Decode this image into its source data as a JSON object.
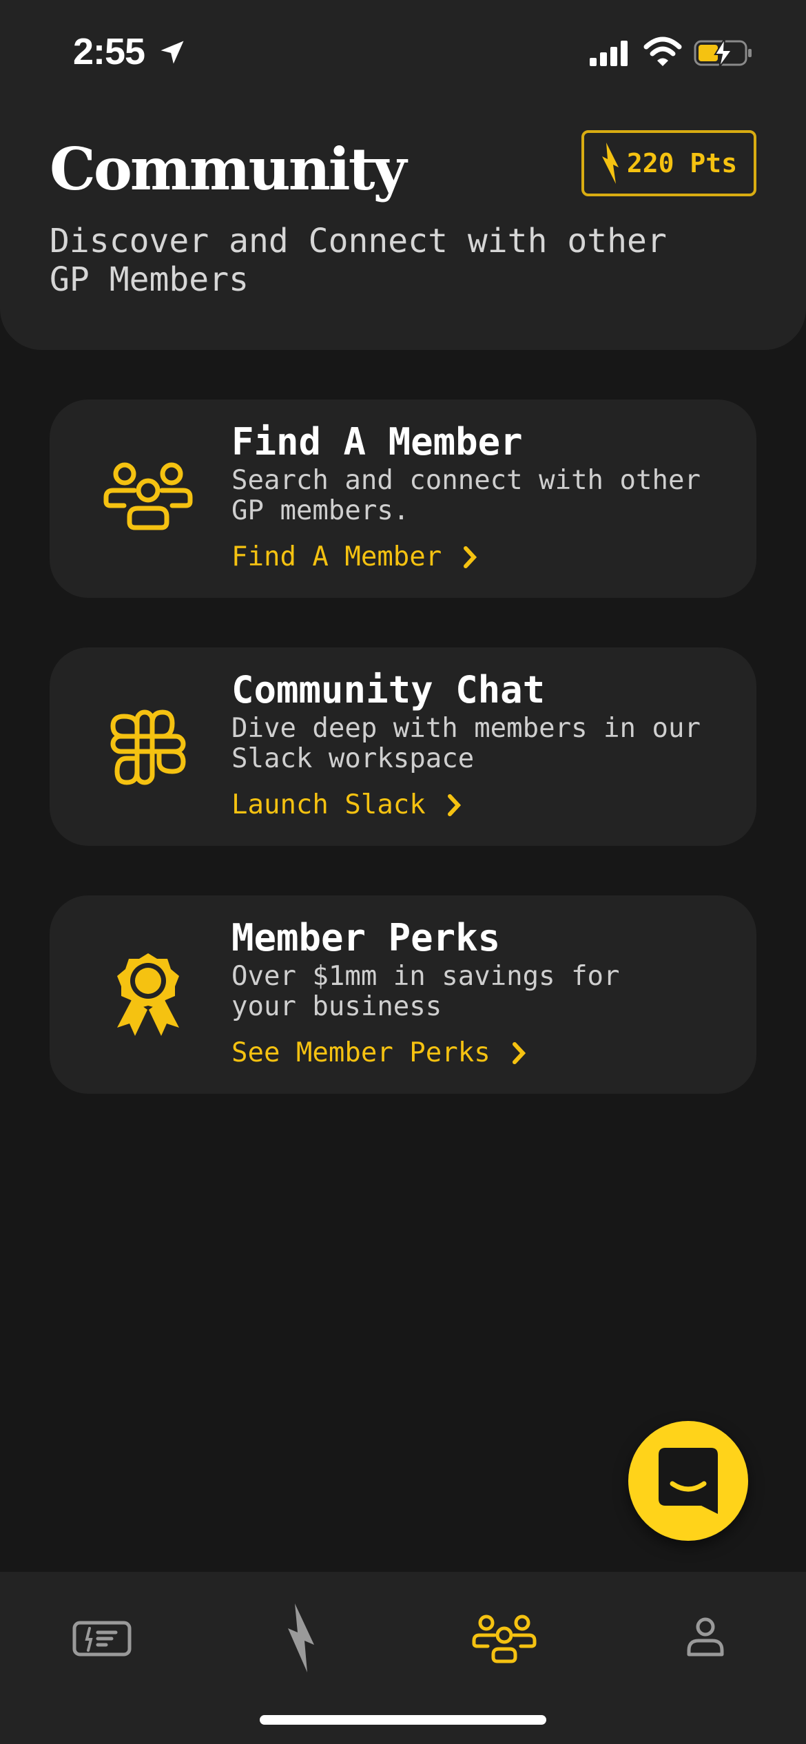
{
  "status_bar": {
    "time": "2:55",
    "icons": [
      "location-arrow-icon",
      "cellular-signal-icon",
      "wifi-icon",
      "battery-charging-icon"
    ]
  },
  "header": {
    "title": "Community",
    "points": "220 Pts",
    "subtitle": "Discover and Connect with other\nGP Members"
  },
  "cards": [
    {
      "icon": "users-group-icon",
      "title": "Find A Member",
      "description": "Search and connect with other\nGP members.",
      "link": "Find A Member"
    },
    {
      "icon": "slack-icon",
      "title": "Community Chat",
      "description": "Dive deep with members in our\nSlack workspace",
      "link": "Launch Slack"
    },
    {
      "icon": "award-ribbon-icon",
      "title": "Member Perks",
      "description": "Over $1mm in savings for\nyour business",
      "link": "See Member Perks"
    }
  ],
  "fab": {
    "icon": "chat-bubble-icon"
  },
  "tab_bar": {
    "tabs": [
      {
        "icon": "membership-card-icon",
        "active": false
      },
      {
        "icon": "lightning-bolt-icon",
        "active": false
      },
      {
        "icon": "community-users-icon",
        "active": true
      },
      {
        "icon": "profile-icon",
        "active": false
      }
    ]
  },
  "colors": {
    "background": "#171717",
    "surface": "#232323",
    "accent": "#f5c211",
    "fab": "#ffd31a",
    "text_primary": "#ffffff",
    "text_secondary": "#cfcfcf",
    "tab_inactive": "#9a9a9a"
  }
}
